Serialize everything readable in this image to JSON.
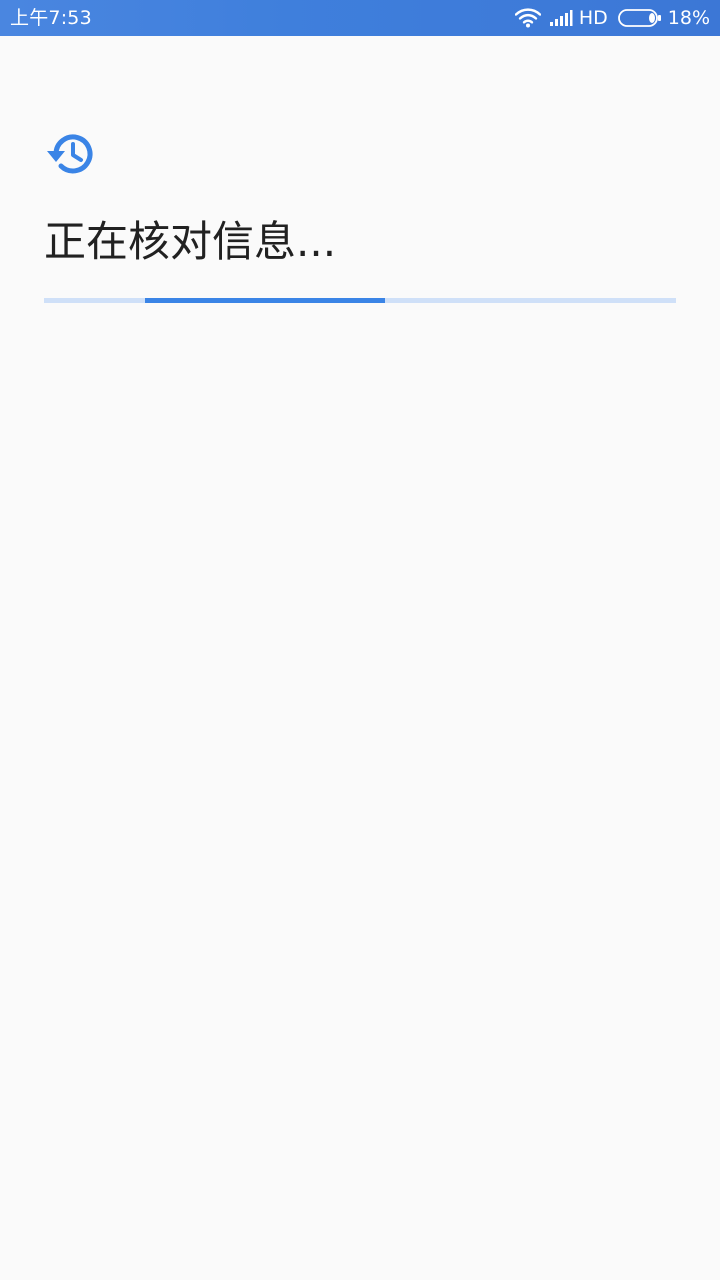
{
  "status_bar": {
    "time": "上午7:53",
    "network": "HD",
    "battery": "18%",
    "battery_level": 0.18
  },
  "page": {
    "title": "正在核对信息..."
  },
  "progress": {
    "indeterminate": true,
    "segment_start": 0.16,
    "segment_end": 0.54
  },
  "colors": {
    "accent": "#3a84e6",
    "track": "#cfe0f8",
    "background": "#fafafa",
    "status_bar": "#4080dc",
    "text": "#212121"
  },
  "icons": {
    "header": "history-icon",
    "wifi": "wifi-icon",
    "signal": "signal-icon",
    "battery": "battery-icon"
  }
}
